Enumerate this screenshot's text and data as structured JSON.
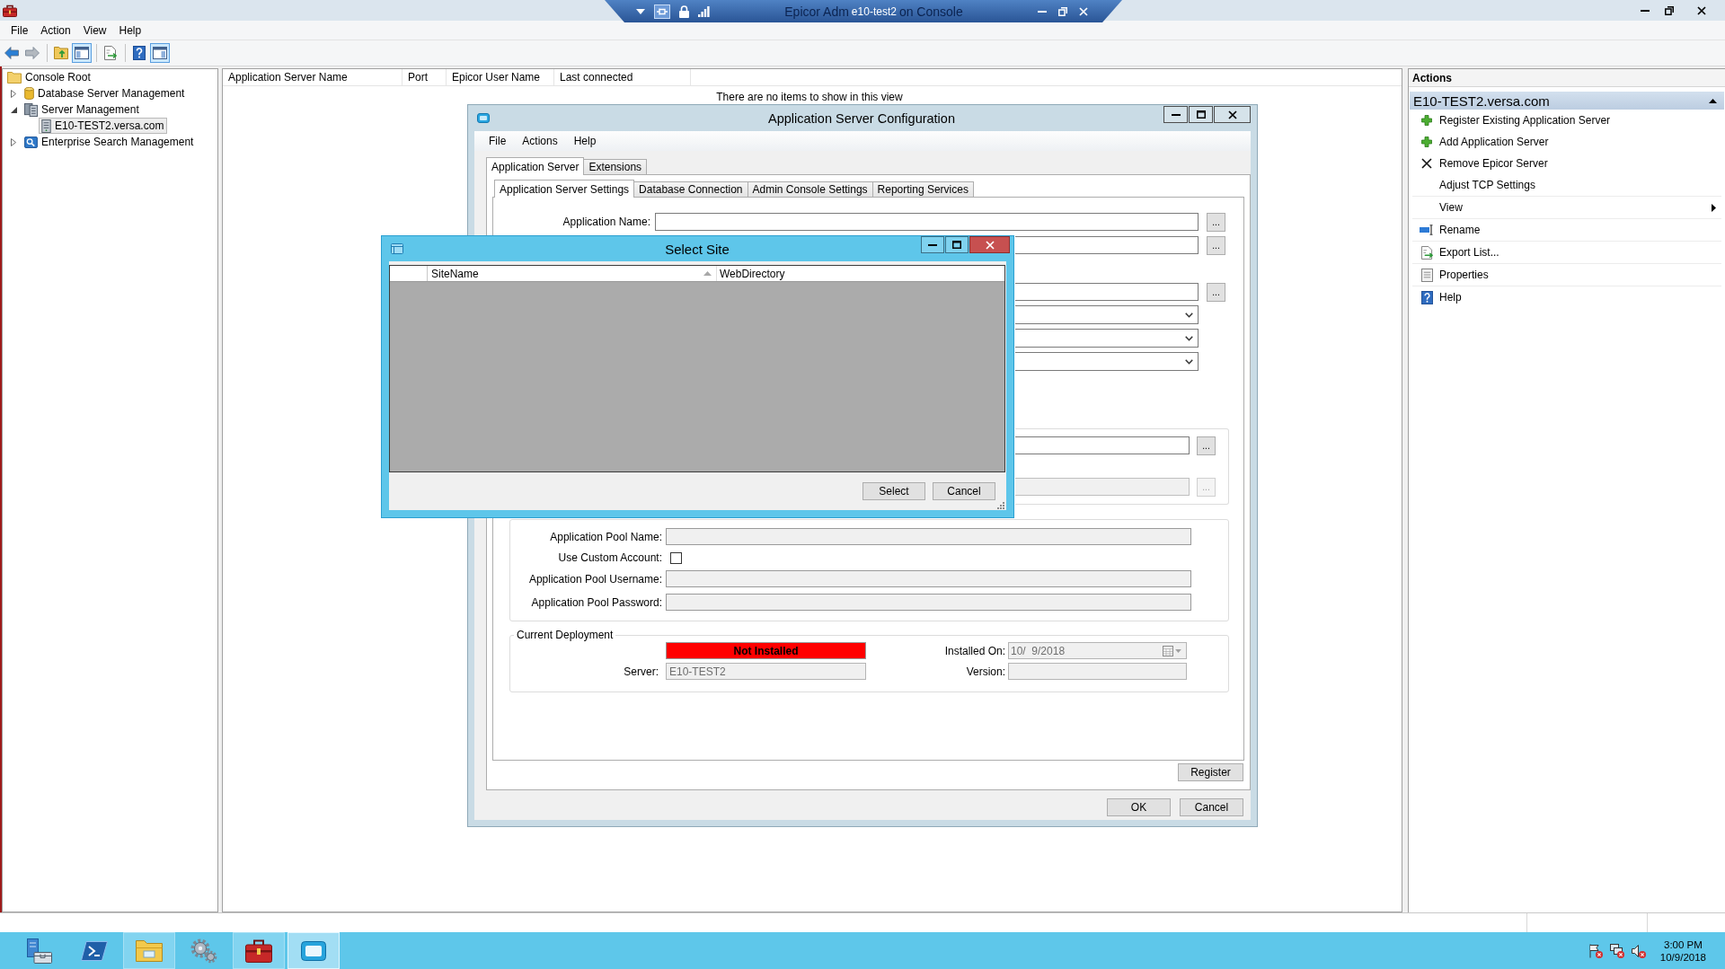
{
  "remote_bar": {
    "host": "e10-test2",
    "title_behind": [
      "Epicor Adm",
      "on Console"
    ]
  },
  "menu": [
    "File",
    "Action",
    "View",
    "Help"
  ],
  "toolbar": [
    [
      {
        "kind": "back",
        "pressed": false,
        "disabled": false
      },
      {
        "kind": "forward",
        "pressed": false,
        "disabled": true
      }
    ],
    [
      {
        "kind": "up-folder",
        "pressed": false,
        "disabled": false
      },
      {
        "kind": "console-tree",
        "pressed": true,
        "disabled": false
      }
    ],
    [
      {
        "kind": "export",
        "pressed": false,
        "disabled": false
      }
    ],
    [
      {
        "kind": "help",
        "pressed": false,
        "disabled": false
      },
      {
        "kind": "action-pane",
        "pressed": true,
        "disabled": false
      }
    ]
  ],
  "tree": [
    {
      "label": "Console Root",
      "kind": "folder",
      "selected": false,
      "children": [
        {
          "label": "Database Server Management",
          "kind": "database",
          "selected": false,
          "expanded": false
        },
        {
          "label": "Server Management",
          "kind": "server-group",
          "selected": false,
          "expanded": true,
          "children": [
            {
              "label": "E10-TEST2.versa.com",
              "kind": "server",
              "selected": true
            }
          ]
        },
        {
          "label": "Enterprise Search Management",
          "kind": "search",
          "selected": false,
          "expanded": false
        }
      ]
    }
  ],
  "list_view": {
    "columns": [
      "Application Server Name",
      "Port",
      "Epicor User Name",
      "Last connected"
    ],
    "empty_message": "There are no items to show in this view"
  },
  "actions": {
    "title": "Actions",
    "section": {
      "title": "E10-TEST2.versa.com",
      "expanded": true
    },
    "groups": [
      [
        {
          "label": "Register Existing Application Server",
          "kind": "add"
        },
        {
          "label": "Add Application Server",
          "kind": "add"
        },
        {
          "label": "Remove Epicor Server",
          "kind": "remove"
        },
        {
          "label": "Adjust TCP Settings",
          "kind": "plain"
        }
      ],
      [
        {
          "label": "View",
          "kind": "submenu"
        }
      ],
      [
        {
          "label": "Rename",
          "kind": "rename"
        }
      ],
      [
        {
          "label": "Export List...",
          "kind": "export"
        }
      ],
      [
        {
          "label": "Properties",
          "kind": "properties"
        }
      ],
      [
        {
          "label": "Help",
          "kind": "help"
        }
      ]
    ]
  },
  "config_dialog": {
    "title": "Application Server Configuration",
    "menu": [
      "File",
      "Actions",
      "Help"
    ],
    "tabs": [
      {
        "label": "Application Server",
        "selected": true
      },
      {
        "label": "Extensions",
        "selected": false
      }
    ],
    "subtabs": [
      {
        "label": "Application Server Settings",
        "selected": true
      },
      {
        "label": "Database Connection",
        "selected": false
      },
      {
        "label": "Admin Console Settings",
        "selected": false
      },
      {
        "label": "Reporting Services",
        "selected": false
      }
    ],
    "name_rows": [
      {
        "kind": "browse",
        "label": "Application Name:",
        "button": "...",
        "disabled": false
      },
      {
        "kind": "browse",
        "button": "...",
        "disabled": false
      }
    ],
    "site_rows": [
      {
        "kind": "browse",
        "button": "...",
        "disabled": false
      },
      {
        "kind": "dropdown",
        "disabled": false
      },
      {
        "kind": "dropdown",
        "disabled": false
      },
      {
        "kind": "dropdown",
        "disabled": false
      }
    ],
    "site_group": [
      {
        "button": "...",
        "disabled": false
      },
      {
        "button": "...",
        "disabled": true
      }
    ],
    "app_pool": [
      {
        "kind": "text",
        "label": "Application Pool Name:",
        "disabled": true
      },
      {
        "kind": "checkbox",
        "label": "Use Custom Account:",
        "checked": false
      },
      {
        "kind": "text",
        "label": "Application Pool Username:",
        "disabled": true
      },
      {
        "kind": "text",
        "label": "Application Pool Password:",
        "disabled": true
      }
    ],
    "deployment": {
      "legend": "Current Deployment",
      "status": {
        "text": "Not Installed",
        "installed": false
      },
      "server": {
        "label": "Server:",
        "value": "E10-TEST2"
      },
      "installed_on": {
        "label": "Installed On:",
        "value": "10/  9/2018"
      },
      "version": {
        "label": "Version:"
      }
    },
    "register_button": "Register",
    "buttons": [
      "OK",
      "Cancel"
    ]
  },
  "select_site": {
    "title": "Select Site",
    "columns": [
      {
        "label": "SiteName",
        "sorted": true
      },
      {
        "label": "WebDirectory",
        "sorted": false
      }
    ],
    "buttons": [
      "Select",
      "Cancel"
    ]
  },
  "taskbar": {
    "items": [
      {
        "kind": "server-manager",
        "open": false,
        "active": false
      },
      {
        "kind": "powershell",
        "open": false,
        "active": false
      },
      {
        "kind": "explorer",
        "open": true,
        "active": false
      },
      {
        "kind": "settings",
        "open": false,
        "active": false
      },
      {
        "kind": "toolbox",
        "open": true,
        "active": false
      },
      {
        "kind": "remote-app",
        "open": true,
        "active": true
      }
    ],
    "tray": [
      {
        "kind": "flag"
      },
      {
        "kind": "network"
      },
      {
        "kind": "volume"
      }
    ],
    "clock": {
      "time": "3:00 PM",
      "date": "10/9/2018"
    }
  }
}
